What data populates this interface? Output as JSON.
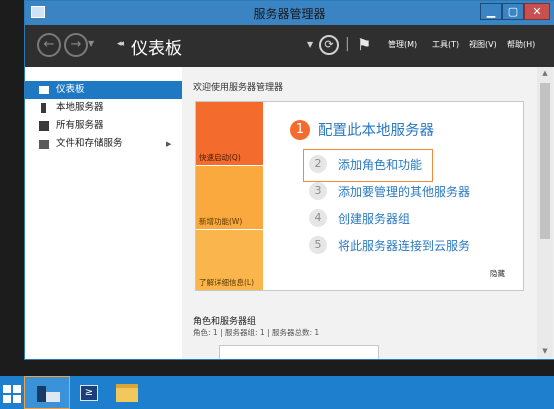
{
  "window": {
    "title": "服务器管理器",
    "controls": {
      "minimize": "▁",
      "maximize": "▢",
      "close": "✕"
    }
  },
  "toolbar": {
    "back_icon": "←",
    "forward_icon": "→",
    "breadcrumb_arrows": "◂◂",
    "page_title": "仪表板",
    "refresh_icon": "⟳",
    "flag_icon": "⚑",
    "menus": [
      "管理(M)",
      "工具(T)",
      "视图(V)",
      "帮助(H)"
    ]
  },
  "sidebar": {
    "items": [
      {
        "label": "仪表板",
        "icon": "dashboard-grid-icon",
        "selected": true
      },
      {
        "label": "本地服务器",
        "icon": "server-icon"
      },
      {
        "label": "所有服务器",
        "icon": "servers-icon"
      },
      {
        "label": "文件和存储服务",
        "icon": "storage-icon",
        "expand": "▶"
      }
    ]
  },
  "main": {
    "welcome": "欢迎使用服务器管理器",
    "tiles": [
      "快速启动(Q)",
      "新增功能(W)",
      "了解详细信息(L)"
    ],
    "step1": {
      "num": "1",
      "title": "配置此本地服务器"
    },
    "steps": [
      {
        "num": "2",
        "label": "添加角色和功能"
      },
      {
        "num": "3",
        "label": "添加要管理的其他服务器"
      },
      {
        "num": "4",
        "label": "创建服务器组"
      },
      {
        "num": "5",
        "label": "将此服务器连接到云服务"
      }
    ],
    "hide": "隐藏",
    "roles_title": "角色和服务器组",
    "roles_counts": "角色: 1 | 服务器组: 1 | 服务器总数: 1"
  },
  "taskbar": {
    "powershell": "≥"
  },
  "colors": {
    "accent": "#1f79c2",
    "quickstart_tile": "#f36b2d",
    "whatsnew_tile": "#f9a93e",
    "learnmore_tile": "#fbb54d",
    "taskbar": "#1e7fcf"
  }
}
